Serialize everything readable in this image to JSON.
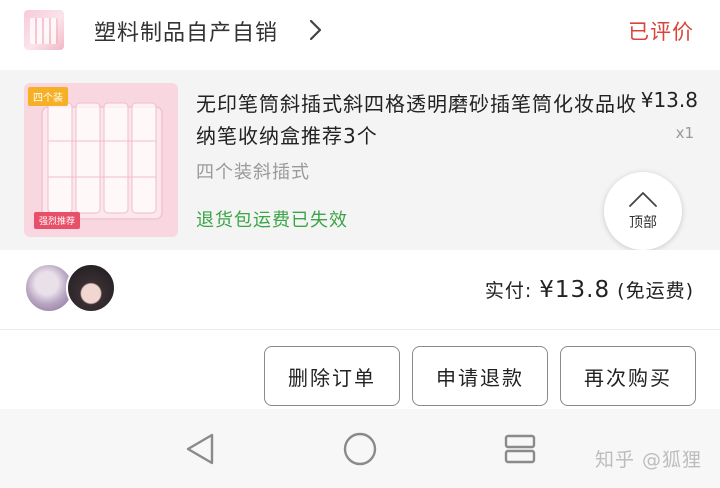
{
  "shop": {
    "name": "塑料制品自产自销",
    "order_status": "已评价"
  },
  "product": {
    "badge_top": "四个装",
    "badge_bottom": "强烈推荐",
    "title": "无印笔筒斜插式斜四格透明磨砂插笔筒化妆品收纳笔收纳盒推荐3个",
    "sku": "四个装斜插式",
    "price": "¥13.8",
    "quantity": "x1",
    "refund_note": "退货包运费已失效"
  },
  "back_to_top": {
    "label": "顶部"
  },
  "summary": {
    "prefix": "实付:",
    "amount": "¥13.8",
    "suffix": "(免运费)"
  },
  "actions": {
    "delete": "删除订单",
    "refund": "申请退款",
    "rebuy": "再次购买"
  },
  "watermark": "知乎 @狐狸",
  "colors": {
    "status_red": "#d8453b",
    "refund_green": "#3aa546",
    "thumb_pink": "#f9d7e0"
  },
  "icons": [
    "chevron-right-icon",
    "arrow-up-icon",
    "nav-back-icon",
    "nav-home-icon",
    "nav-recent-icon"
  ]
}
